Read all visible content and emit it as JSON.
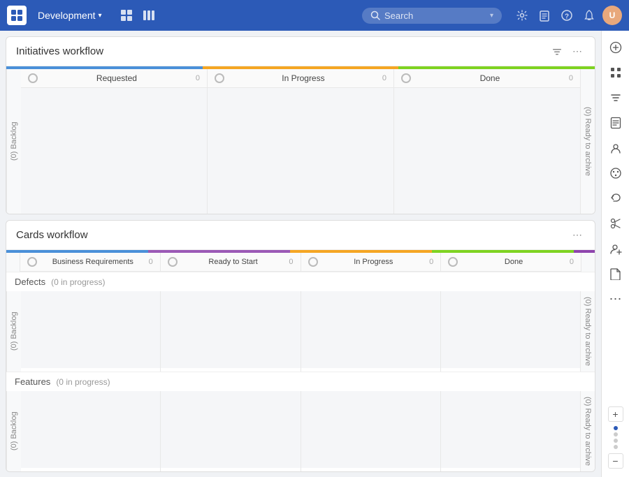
{
  "topnav": {
    "project_name": "Development",
    "search_placeholder": "Search",
    "logo_aria": "app-logo"
  },
  "initiatives_workflow": {
    "title": "Initiatives workflow",
    "columns": [
      {
        "label": "Requested",
        "count": "0",
        "color": "#4a90d9"
      },
      {
        "label": "In Progress",
        "count": "0",
        "color": "#f5a623"
      },
      {
        "label": "Done",
        "count": "0",
        "color": "#7ed321"
      }
    ],
    "backlog_label": "(0) Backlog",
    "archive_label": "(0) Ready to archive",
    "progress_segments": [
      {
        "color": "#4a90d9",
        "flex": 1
      },
      {
        "color": "#f5a623",
        "flex": 1
      },
      {
        "color": "#7ed321",
        "flex": 1
      }
    ]
  },
  "cards_workflow": {
    "title": "Cards workflow",
    "columns": [
      {
        "label": "Business Requirements",
        "count": "0",
        "color": "#4a90d9"
      },
      {
        "label": "Ready to Start",
        "count": "0",
        "color": "#9b59b6"
      },
      {
        "label": "In Progress",
        "count": "0",
        "color": "#f5a623"
      },
      {
        "label": "Done",
        "count": "0",
        "color": "#7ed321"
      }
    ],
    "backlog_label": "(0) Backlog",
    "archive_label": "(0) Ready to archive",
    "progress_segments": [
      {
        "color": "#4a90d9",
        "flex": 1
      },
      {
        "color": "#9b59b6",
        "flex": 1
      },
      {
        "color": "#f5a623",
        "flex": 1
      },
      {
        "color": "#7ed321",
        "flex": 1
      },
      {
        "color": "#8e44ad",
        "flex": 0.15
      }
    ],
    "swimlanes": [
      {
        "label": "Defects",
        "sub": "(0 in progress)"
      },
      {
        "label": "Features",
        "sub": "(0 in progress)"
      }
    ]
  },
  "right_sidebar": {
    "icons": [
      "⊞",
      "⋮⋮",
      "☰",
      "📋",
      "👥",
      "🎨",
      "↩",
      "✂",
      "👤+",
      "📄",
      "⋯"
    ]
  },
  "scroll": {
    "dots": [
      {
        "active": true
      },
      {
        "active": false
      },
      {
        "active": false
      },
      {
        "active": false
      }
    ]
  }
}
